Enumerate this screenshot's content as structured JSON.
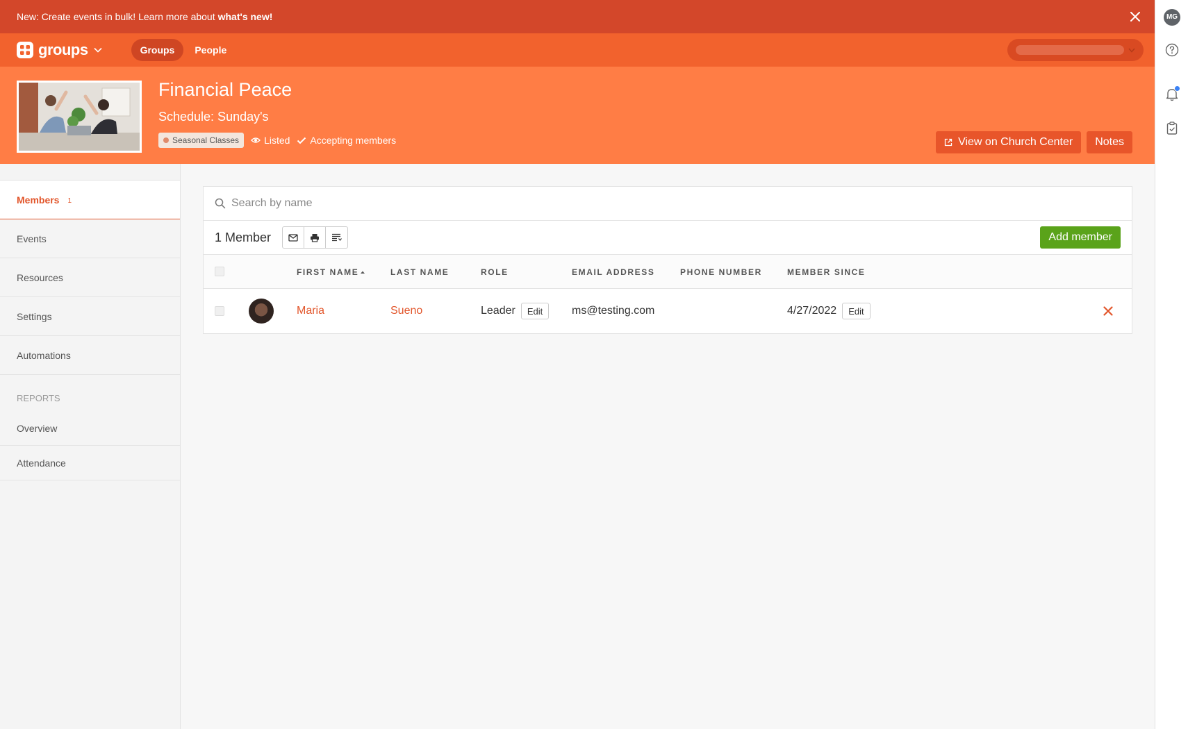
{
  "announcement": {
    "text": "New: Create events in bulk! Learn more about ",
    "link": "what's new!"
  },
  "nav": {
    "app_name": "groups",
    "tabs": [
      {
        "label": "Groups",
        "active": true
      },
      {
        "label": "People",
        "active": false
      }
    ]
  },
  "rail": {
    "user_initials": "MG"
  },
  "group": {
    "name": "Financial Peace",
    "schedule": "Schedule: Sunday's",
    "type_badge": "Seasonal Classes",
    "visibility": "Listed",
    "enrollment": "Accepting members",
    "actions": {
      "church_center": "View on Church Center",
      "notes": "Notes"
    }
  },
  "sidebar": {
    "items": [
      {
        "label": "Members",
        "count": "1",
        "active": true
      },
      {
        "label": "Events"
      },
      {
        "label": "Resources"
      },
      {
        "label": "Settings"
      },
      {
        "label": "Automations"
      }
    ],
    "reports_heading": "REPORTS",
    "reports": [
      {
        "label": "Overview"
      },
      {
        "label": "Attendance"
      }
    ]
  },
  "members": {
    "search_placeholder": "Search by name",
    "count_label": "1 Member",
    "add_button": "Add member",
    "columns": {
      "first_name": "FIRST NAME",
      "last_name": "LAST NAME",
      "role": "ROLE",
      "email": "EMAIL ADDRESS",
      "phone": "PHONE NUMBER",
      "member_since": "MEMBER SINCE"
    },
    "rows": [
      {
        "first_name": "Maria",
        "last_name": "Sueno",
        "role": "Leader",
        "email": "ms@testing.com",
        "phone": "",
        "member_since": "4/27/2022",
        "edit_label": "Edit"
      }
    ]
  },
  "colors": {
    "announcement_bg": "#d3472a",
    "nav_bg": "#f2622d",
    "hero_bg": "#ff7d45",
    "accent": "#e2552a",
    "add_button_bg": "#5aa31a",
    "notification_dot": "#3b82f6"
  }
}
